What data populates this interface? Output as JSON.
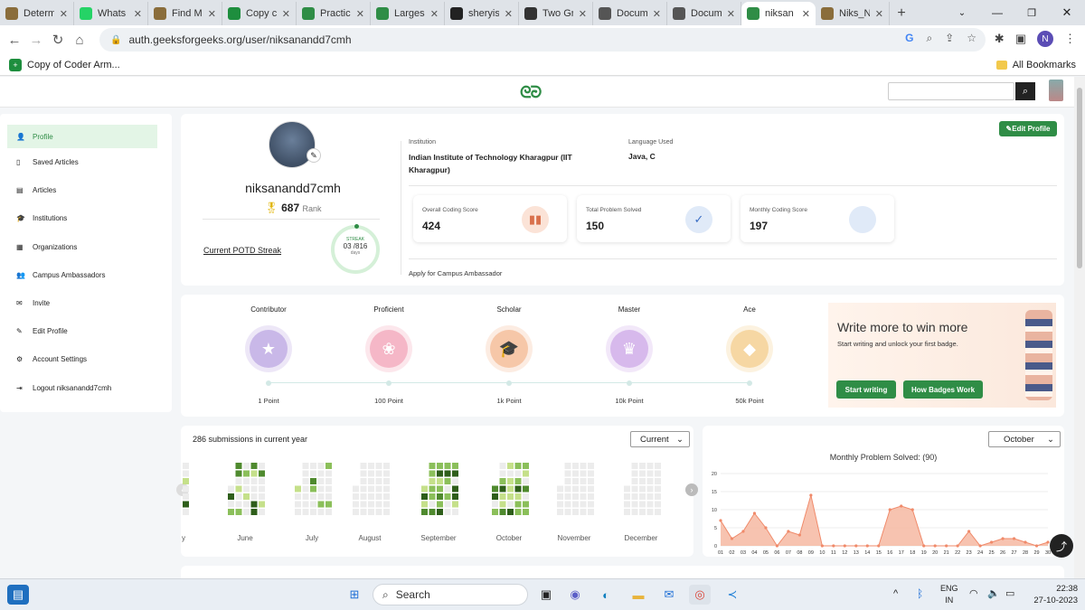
{
  "browser": {
    "tabs": [
      {
        "label": "Determ",
        "icon": "gfg-icon",
        "color": "#8a6d3b"
      },
      {
        "label": "Whats",
        "icon": "whatsapp-icon",
        "color": "#25d366"
      },
      {
        "label": "Find M",
        "icon": "gfg-icon",
        "color": "#8a6d3b"
      },
      {
        "label": "Copy c",
        "icon": "sheets-icon",
        "color": "#1e8e3e"
      },
      {
        "label": "Practic",
        "icon": "gfg-icon",
        "color": "#2f8d46"
      },
      {
        "label": "Larges",
        "icon": "gfg-icon",
        "color": "#2f8d46"
      },
      {
        "label": "sheryis",
        "icon": "github-icon",
        "color": "#222222"
      },
      {
        "label": "Two Gr",
        "icon": "puzzle-icon",
        "color": "#333333"
      },
      {
        "label": "Docum",
        "icon": "globe-icon",
        "color": "#555555"
      },
      {
        "label": "Docum",
        "icon": "globe-icon",
        "color": "#555555"
      },
      {
        "label": "niksan",
        "icon": "gfg-icon",
        "color": "#2f8d46"
      },
      {
        "label": "Niks_N",
        "icon": "gfg-icon",
        "color": "#8a6d3b"
      }
    ],
    "active_tab": 10,
    "url": "auth.geeksforgeeks.org/user/niksanandd7cmh",
    "profile_initial": "N",
    "bookmark": "Copy of Coder Arm...",
    "all_bookmarks": "All Bookmarks"
  },
  "site": {
    "logo": "GfG",
    "search_placeholder": ""
  },
  "sidebar": {
    "items": [
      {
        "label": "Profile",
        "icon": "person-icon"
      },
      {
        "label": "Saved Articles",
        "icon": "bookmark-icon"
      },
      {
        "label": "Articles",
        "icon": "document-icon"
      },
      {
        "label": "Institutions",
        "icon": "graduation-cap-icon"
      },
      {
        "label": "Organizations",
        "icon": "building-icon"
      },
      {
        "label": "Campus Ambassadors",
        "icon": "group-icon"
      },
      {
        "label": "Invite",
        "icon": "mail-icon"
      },
      {
        "label": "Edit Profile",
        "icon": "pencil-icon"
      },
      {
        "label": "Account Settings",
        "icon": "gear-icon"
      },
      {
        "label": "Logout niksanandd7cmh",
        "icon": "logout-icon"
      }
    ]
  },
  "profile": {
    "username": "niksanandd7cmh",
    "rank": "687",
    "rank_label": "Rank",
    "potd_label": "Current POTD Streak",
    "streak_label": "STREAK",
    "streak_current": "03",
    "streak_total": "/816",
    "streak_unit": "days",
    "institution_label": "Institution",
    "institution": "Indian Institute of Technology Kharagpur (IIT Kharagpur)",
    "language_label": "Language Used",
    "language": "Java, C",
    "edit_button": "Edit Profile",
    "campus_link": "Apply for Campus Ambassador",
    "stats": [
      {
        "label": "Overall Coding Score",
        "value": "424",
        "icon": "bar-chart-icon"
      },
      {
        "label": "Total Problem Solved",
        "value": "150",
        "icon": "check-circle-icon"
      },
      {
        "label": "Monthly Coding Score",
        "value": "197",
        "icon": "code-icon"
      }
    ]
  },
  "badges": {
    "levels": [
      {
        "name": "Contributor",
        "points": "1 Point",
        "color": "#c9b8e8",
        "icon": "star-icon"
      },
      {
        "name": "Proficient",
        "points": "100 Point",
        "color": "#f5b7c7",
        "icon": "ribbon-icon"
      },
      {
        "name": "Scholar",
        "points": "1k Point",
        "color": "#f6c7a8",
        "icon": "mortarboard-icon"
      },
      {
        "name": "Master",
        "points": "10k Point",
        "color": "#d7b9ec",
        "icon": "crown-icon"
      },
      {
        "name": "Ace",
        "points": "50k Point",
        "color": "#f6d7a3",
        "icon": "diamond-icon"
      }
    ],
    "promo_title": "Write more to win more",
    "promo_sub": "Start writing and unlock your first badge.",
    "start_button": "Start writing",
    "how_button": "How Badges Work"
  },
  "submissions": {
    "title": "286 submissions in current year",
    "select": "Current",
    "months": [
      "y",
      "June",
      "July",
      "August",
      "September",
      "October",
      "November",
      "December"
    ]
  },
  "monthly_chart": {
    "select": "October",
    "title": "Monthly Problem Solved: (90)"
  },
  "chart_data": {
    "type": "area",
    "title": "Monthly Problem Solved: (90)",
    "xlabel": "",
    "ylabel": "",
    "x": [
      "01",
      "02",
      "03",
      "04",
      "05",
      "06",
      "07",
      "08",
      "09",
      "10",
      "11",
      "12",
      "13",
      "14",
      "15",
      "16",
      "17",
      "18",
      "19",
      "20",
      "21",
      "22",
      "23",
      "24",
      "25",
      "26",
      "27",
      "28",
      "29",
      "30"
    ],
    "series": [
      {
        "values": [
          7,
          2,
          4,
          9,
          5,
          0,
          4,
          3,
          14,
          0,
          0,
          0,
          0,
          0,
          0,
          10,
          11,
          10,
          0,
          0,
          0,
          0,
          4,
          0,
          1,
          2,
          2,
          1,
          0,
          1
        ]
      }
    ],
    "ylim": [
      0,
      20
    ],
    "yticks": [
      "0",
      "5",
      "10",
      "15",
      "20"
    ],
    "grid": true,
    "color": "#f08a6a"
  },
  "taskbar": {
    "search": "Search",
    "lang1": "ENG",
    "lang2": "IN",
    "time": "22:38",
    "date": "27-10-2023"
  }
}
